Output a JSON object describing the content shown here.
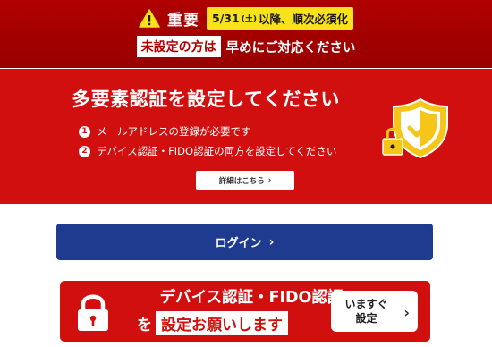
{
  "notice": {
    "important": "重要",
    "date_main": "5/31",
    "date_sat": "(土)",
    "date_rest": "以降、順次必須化",
    "unset_badge": "未設定の方は",
    "sub": "早めにご対応ください"
  },
  "mfa": {
    "title": "多要素認証を設定してください",
    "items": [
      {
        "num": "1",
        "text": "メールアドレスの登録が必要です"
      },
      {
        "num": "2",
        "text": "デバイス認証・FIDO認証の両方を設定してください"
      }
    ],
    "detail_label": "詳細はこちら",
    "detail_chevron": "›"
  },
  "login": {
    "label": "ログイン",
    "chevron": "›"
  },
  "cta": {
    "line1": "デバイス認証・FIDO認証",
    "wo": "を",
    "set": "設定お願いします",
    "now_line1": "いますぐ",
    "now_line2": "設定",
    "chevron": "›"
  },
  "colors": {
    "notice_bg": "#a80000",
    "panel_red": "#d20f0f",
    "login_blue": "#1f3b8f",
    "badge_yellow": "#f7e21b",
    "shield_gold": "#f5c518"
  },
  "icons": [
    "warning-icon",
    "shield-icon",
    "lock-icon",
    "chevron-right-icon"
  ]
}
